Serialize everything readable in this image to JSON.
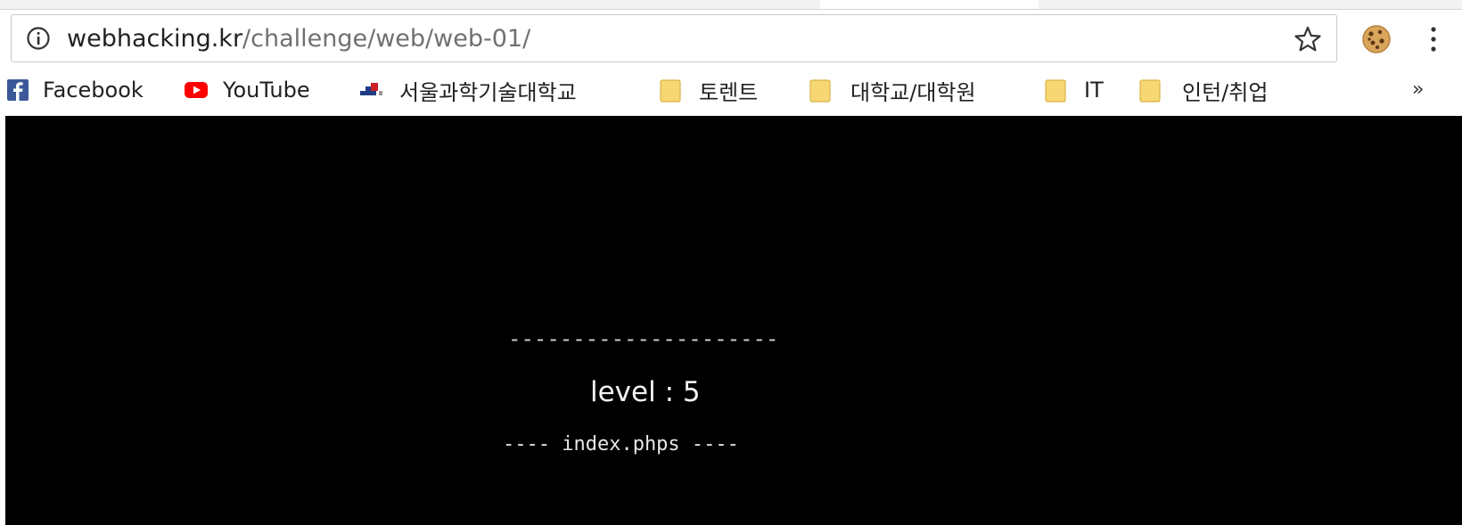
{
  "browser": {
    "url_host": "webhacking.kr",
    "url_path": "/challenge/web/web-01/"
  },
  "bookmarks": [
    {
      "label": "Facebook",
      "icon": "facebook-icon"
    },
    {
      "label": "YouTube",
      "icon": "youtube-icon"
    },
    {
      "label": "서울과학기술대학교",
      "icon": "university-logo-icon"
    },
    {
      "label": "토렌트",
      "icon": "folder-icon"
    },
    {
      "label": "대학교/대학원",
      "icon": "folder-icon"
    },
    {
      "label": "IT",
      "icon": "folder-icon"
    },
    {
      "label": "인턴/취업",
      "icon": "folder-icon"
    }
  ],
  "bookmarks_more": "»",
  "page": {
    "separator": "---------------------",
    "level_text": "level : 5",
    "source_link": "---- index.phps ----"
  },
  "colors": {
    "page_background": "#000000",
    "page_text": "#ffffff",
    "folder": "#f7d774",
    "youtube": "#ff0000",
    "facebook": "#3b5998"
  }
}
